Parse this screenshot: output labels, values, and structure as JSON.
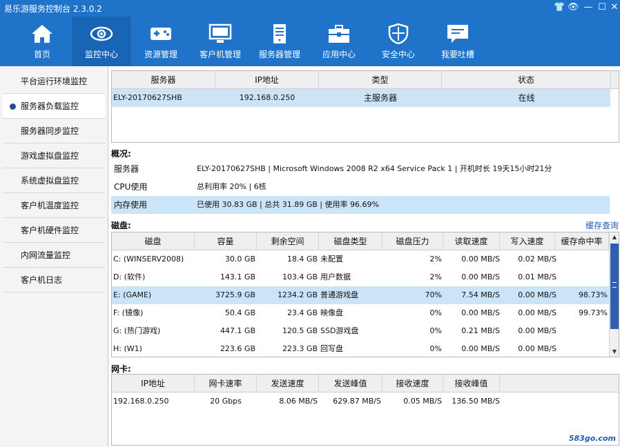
{
  "app": {
    "title": "易乐游服务控制台 2.3.0.2"
  },
  "window_controls": {
    "tshirt": "👕",
    "view": "👁",
    "minimize": "—",
    "maximize": "☐",
    "close": "✕"
  },
  "nav": [
    {
      "label": "首页",
      "icon": "home-icon"
    },
    {
      "label": "监控中心",
      "icon": "eye-icon"
    },
    {
      "label": "资源管理",
      "icon": "gamepad-icon"
    },
    {
      "label": "客户机管理",
      "icon": "monitor-icon"
    },
    {
      "label": "服务器管理",
      "icon": "server-icon"
    },
    {
      "label": "应用中心",
      "icon": "toolbox-icon"
    },
    {
      "label": "安全中心",
      "icon": "shield-icon"
    },
    {
      "label": "我要吐槽",
      "icon": "chat-icon"
    }
  ],
  "sidebar": [
    "平台运行环境监控",
    "服务器负载监控",
    "服务器同步监控",
    "游戏虚拟盘监控",
    "系统虚拟盘监控",
    "客户机温度监控",
    "客户机硬件监控",
    "内网流量监控",
    "客户机日志"
  ],
  "servers": {
    "headers": [
      "服务器",
      "IP地址",
      "类型",
      "状态"
    ],
    "rows": [
      {
        "name": "ELY-20170627SHB",
        "ip": "192.168.0.250",
        "type": "主服务器",
        "status": "在线"
      }
    ]
  },
  "overview": {
    "title": "概况:",
    "rows": [
      {
        "key": "服务器",
        "value": "ELY-20170627SHB | Microsoft Windows 2008 R2 x64 Service Pack 1 | 开机时长 19天15小时21分"
      },
      {
        "key": "CPU使用",
        "value": "总利用率 20% | 6核"
      },
      {
        "key": "内存使用",
        "value": "已使用 30.83 GB | 总共 31.89 GB | 使用率 96.69%"
      }
    ]
  },
  "disks": {
    "title": "磁盘:",
    "cache_link": "缓存查询",
    "headers": [
      "磁盘",
      "容量",
      "剩余空间",
      "磁盘类型",
      "磁盘压力",
      "读取速度",
      "写入速度",
      "缓存命中率"
    ],
    "rows": [
      {
        "disk": "C: (WINSERV2008)",
        "capacity": "30.0 GB",
        "free": "18.4 GB",
        "type": "未配置",
        "pressure": "2%",
        "read": "0.00 MB/S",
        "write": "0.02 MB/S",
        "hit": ""
      },
      {
        "disk": "D: (软件)",
        "capacity": "143.1 GB",
        "free": "103.4 GB",
        "type": "用户数据",
        "pressure": "2%",
        "read": "0.00 MB/S",
        "write": "0.01 MB/S",
        "hit": ""
      },
      {
        "disk": "E: (GAME)",
        "capacity": "3725.9 GB",
        "free": "1234.2 GB",
        "type": "普通游戏盘",
        "pressure": "70%",
        "read": "7.54 MB/S",
        "write": "0.00 MB/S",
        "hit": "98.73%"
      },
      {
        "disk": "F: (镜像)",
        "capacity": "50.4 GB",
        "free": "23.4 GB",
        "type": "映像盘",
        "pressure": "0%",
        "read": "0.00 MB/S",
        "write": "0.00 MB/S",
        "hit": "99.73%"
      },
      {
        "disk": "G: (热门游戏)",
        "capacity": "447.1 GB",
        "free": "120.5 GB",
        "type": "SSD游戏盘",
        "pressure": "0%",
        "read": "0.21 MB/S",
        "write": "0.00 MB/S",
        "hit": ""
      },
      {
        "disk": "H: (W1)",
        "capacity": "223.6 GB",
        "free": "223.3 GB",
        "type": "回写盘",
        "pressure": "0%",
        "read": "0.00 MB/S",
        "write": "0.00 MB/S",
        "hit": ""
      }
    ],
    "scroll": {
      "up": "▲",
      "down": "▼"
    }
  },
  "nics": {
    "title": "网卡:",
    "headers": [
      "IP地址",
      "网卡速率",
      "发送速度",
      "发送峰值",
      "接收速度",
      "接收峰值"
    ],
    "rows": [
      {
        "ip": "192.168.0.250",
        "rate": "20 Gbps",
        "send": "8.06 MB/S",
        "send_peak": "629.87 MB/S",
        "recv": "0.05 MB/S",
        "recv_peak": "136.50 MB/S"
      }
    ]
  },
  "watermark": "583go.com"
}
